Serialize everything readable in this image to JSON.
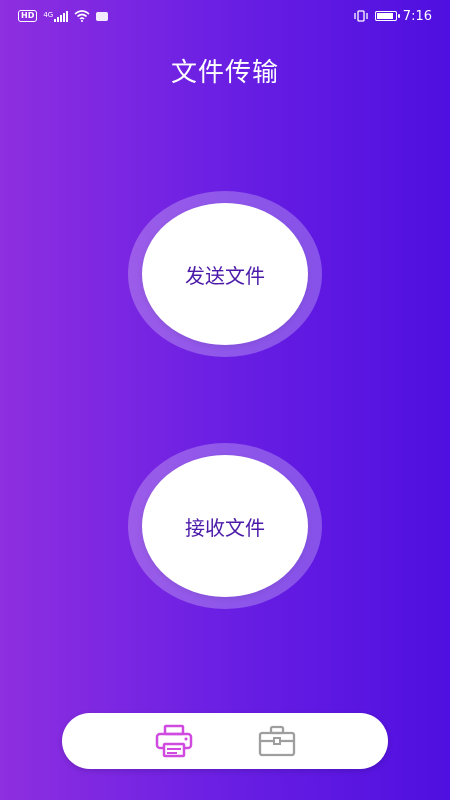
{
  "status_bar": {
    "left_badge": "HD",
    "network": "4G",
    "time": "7:16"
  },
  "title": "文件传输",
  "actions": {
    "send_label": "发送文件",
    "receive_label": "接收文件"
  },
  "bottom_nav": {
    "items": [
      {
        "icon": "printer-icon",
        "active": true,
        "color": "#d04ae0"
      },
      {
        "icon": "toolbox-icon",
        "active": false,
        "color": "#9e9e9e"
      }
    ]
  },
  "colors": {
    "gradient_start": "#8e2fe0",
    "gradient_end": "#4f0fe0",
    "button_text": "#4b1aa8"
  }
}
